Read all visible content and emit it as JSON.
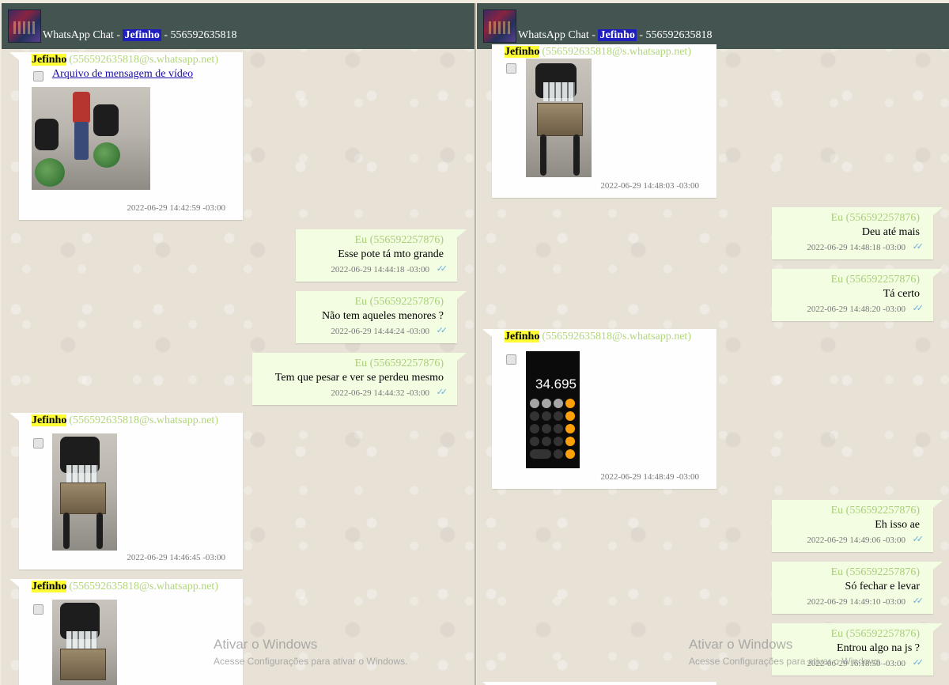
{
  "chat": {
    "title_prefix": "WhatsApp Chat - ",
    "contact_name": "Jefinho",
    "title_suffix": " - 556592635818"
  },
  "contact": {
    "name": "Jefinho",
    "id": "(556592635818@s.whatsapp.net)"
  },
  "me": {
    "label": "Eu (556592257876)"
  },
  "left_messages": [
    {
      "type": "in",
      "link": "Arquivo de mensagem de vídeo",
      "time": "2022-06-29 14:42:59 -03:00"
    },
    {
      "type": "out",
      "text": "Esse pote tá mto grande",
      "time": "2022-06-29 14:44:18 -03:00"
    },
    {
      "type": "out",
      "text": "Não tem aqueles menores ?",
      "time": "2022-06-29 14:44:24 -03:00"
    },
    {
      "type": "out",
      "text": "Tem que pesar e ver se perdeu mesmo",
      "time": "2022-06-29 14:44:32 -03:00"
    },
    {
      "type": "in",
      "image": "photo",
      "time": "2022-06-29 14:46:45 -03:00"
    },
    {
      "type": "in",
      "image": "photo"
    }
  ],
  "right_messages": [
    {
      "type": "in",
      "image": "photo",
      "time": "2022-06-29 14:48:03 -03:00"
    },
    {
      "type": "out",
      "text": "Deu até mais",
      "time": "2022-06-29 14:48:18 -03:00"
    },
    {
      "type": "out",
      "text": "Tá certo",
      "time": "2022-06-29 14:48:20 -03:00"
    },
    {
      "type": "in",
      "image": "calculator-screenshot",
      "time": "2022-06-29 14:48:49 -03:00"
    },
    {
      "type": "out",
      "text": "Eh isso ae",
      "time": "2022-06-29 14:49:06 -03:00"
    },
    {
      "type": "out",
      "text": "Só fechar e levar",
      "time": "2022-06-29 14:49:10 -03:00"
    },
    {
      "type": "out",
      "text": "Entrou algo na js ?",
      "time": "2022-06-29 16:18:50 -03:00"
    }
  ],
  "calculator": {
    "display": "34.695"
  },
  "watermark": {
    "title": "Ativar o Windows",
    "subtitle": "Acesse Configurações para ativar o Windows."
  },
  "icons": {
    "read_receipt": "double-check-icon",
    "avatar": "contact-avatar"
  },
  "colors": {
    "header": "#435451",
    "incoming": "#fefefe",
    "outgoing": "#f3fde2",
    "contact_highlight": "#ffff33",
    "title_highlight": "#1f1fc0",
    "tick": "#6aaee0"
  }
}
